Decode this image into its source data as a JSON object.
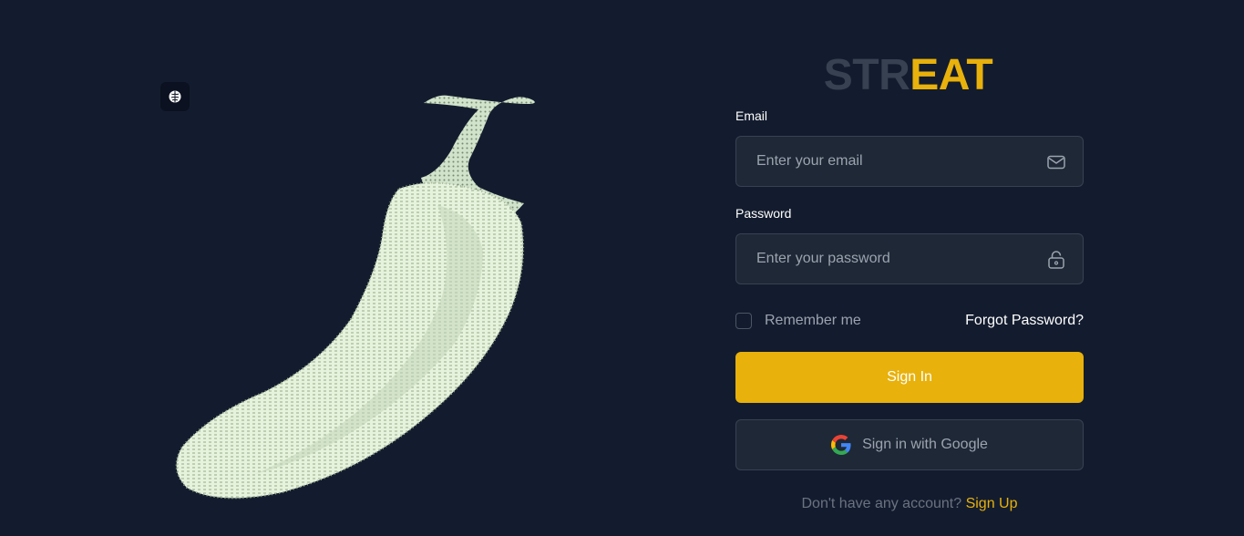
{
  "logo": {
    "part1": "STR",
    "part2": "EAT",
    "color_dark": "#374151",
    "color_accent": "#e8b10b"
  },
  "art": {
    "icon": "brain-icon",
    "illustration": "chili-pepper-ascii-art"
  },
  "email": {
    "label": "Email",
    "placeholder": "Enter your email",
    "value": "",
    "icon": "mail-icon"
  },
  "password": {
    "label": "Password",
    "placeholder": "Enter your password",
    "value": "",
    "icon": "unlock-icon"
  },
  "options": {
    "remember_label": "Remember me",
    "remember_checked": false,
    "forgot_label": "Forgot Password?"
  },
  "signin": {
    "label": "Sign In"
  },
  "google": {
    "label": "Sign in with Google",
    "icon": "google-icon"
  },
  "signup": {
    "prompt": "Don't have any account?",
    "link_label": "Sign Up"
  },
  "colors": {
    "background": "#131c2e",
    "accent": "#e8b10b",
    "field_bg": "#1e2836",
    "field_border": "#374151"
  }
}
